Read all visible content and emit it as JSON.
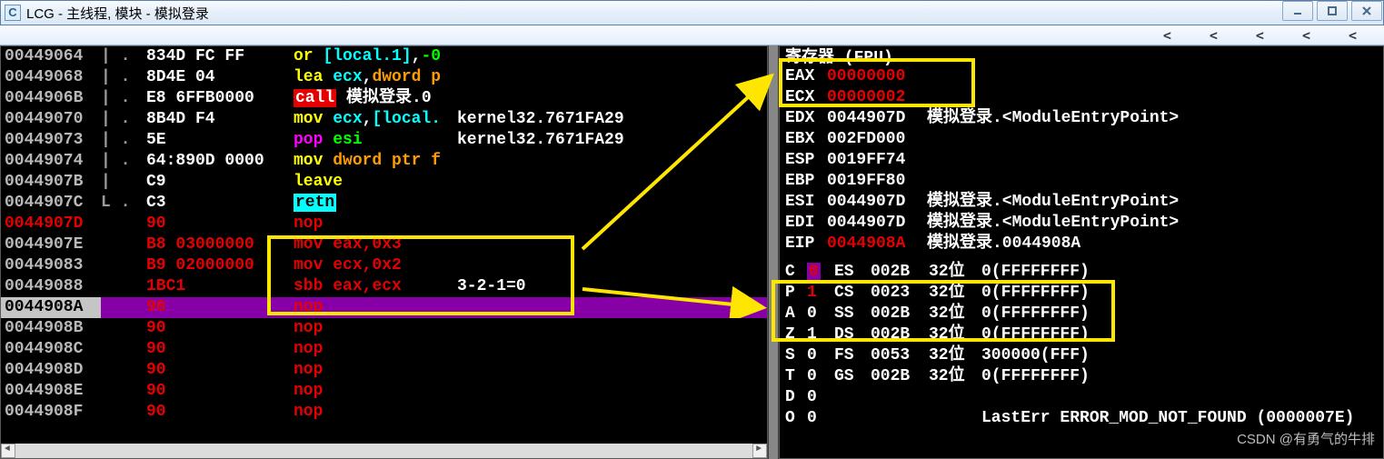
{
  "window": {
    "icon_letter": "C",
    "title": "LCG - 主线程, 模块 - 模拟登录"
  },
  "topmenu": {
    "items": [
      "<",
      "<",
      "<",
      "<",
      "<"
    ]
  },
  "disasm": {
    "rows": [
      {
        "addr": "00449064",
        "addr_cls": "gray",
        "flow": "| .",
        "bytes": "834D FC FF",
        "bcls": "white",
        "dis": [
          {
            "t": "or ",
            "c": "yellow"
          },
          {
            "t": "[local.1]",
            "c": "cyan"
          },
          {
            "t": ",",
            "c": "white"
          },
          {
            "t": "-0",
            "c": "green"
          }
        ],
        "cmt": ""
      },
      {
        "addr": "00449068",
        "addr_cls": "gray",
        "flow": "| .",
        "bytes": "8D4E 04",
        "bcls": "white",
        "dis": [
          {
            "t": "lea ",
            "c": "yellow"
          },
          {
            "t": "ecx",
            "c": "cyan"
          },
          {
            "t": ",",
            "c": "white"
          },
          {
            "t": "dword p",
            "c": "orange"
          }
        ],
        "cmt": ""
      },
      {
        "addr": "0044906B",
        "addr_cls": "gray",
        "flow": "| .",
        "bytes": "E8 6FFB0000",
        "bcls": "white",
        "dis": [
          {
            "t": "call",
            "c": "bg-red"
          },
          {
            "t": " 模拟登录.0",
            "c": "white"
          }
        ],
        "cmt": ""
      },
      {
        "addr": "00449070",
        "addr_cls": "gray",
        "flow": "| .",
        "bytes": "8B4D F4",
        "bcls": "white",
        "dis": [
          {
            "t": "mov ",
            "c": "yellow"
          },
          {
            "t": "ecx",
            "c": "cyan"
          },
          {
            "t": ",",
            "c": "white"
          },
          {
            "t": "[local.",
            "c": "cyan"
          }
        ],
        "cmt": "kernel32.7671FA29"
      },
      {
        "addr": "00449073",
        "addr_cls": "gray",
        "flow": "| .",
        "bytes": "5E",
        "bcls": "white",
        "dis": [
          {
            "t": "pop ",
            "c": "magenta"
          },
          {
            "t": "esi",
            "c": "green"
          }
        ],
        "cmt": "kernel32.7671FA29"
      },
      {
        "addr": "00449074",
        "addr_cls": "gray",
        "flow": "| .",
        "bytes": "64:890D 0000",
        "bcls": "white",
        "dis": [
          {
            "t": "mov ",
            "c": "yellow"
          },
          {
            "t": "dword ptr f",
            "c": "orange"
          }
        ],
        "cmt": ""
      },
      {
        "addr": "0044907B",
        "addr_cls": "gray",
        "flow": "|  ",
        "bytes": "C9",
        "bcls": "white",
        "dis": [
          {
            "t": "leave",
            "c": "yellow"
          }
        ],
        "cmt": ""
      },
      {
        "addr": "0044907C",
        "addr_cls": "gray",
        "flow": "L .",
        "bytes": "C3",
        "bcls": "white",
        "dis": [
          {
            "t": "retn",
            "c": "bg-cyan"
          }
        ],
        "cmt": ""
      },
      {
        "addr": "0044907D",
        "addr_cls": "red",
        "flow": "",
        "bytes": "90",
        "bcls": "red",
        "dis": [
          {
            "t": "nop",
            "c": "red"
          }
        ],
        "cmt": ""
      },
      {
        "addr": "0044907E",
        "addr_cls": "gray",
        "flow": "",
        "bytes": "B8 03000000",
        "bcls": "red",
        "dis": [
          {
            "t": "mov ",
            "c": "red"
          },
          {
            "t": "eax",
            "c": "red"
          },
          {
            "t": ",0x3",
            "c": "red"
          }
        ],
        "cmt": ""
      },
      {
        "addr": "00449083",
        "addr_cls": "gray",
        "flow": "",
        "bytes": "B9 02000000",
        "bcls": "red",
        "dis": [
          {
            "t": "mov ",
            "c": "red"
          },
          {
            "t": "ecx",
            "c": "red"
          },
          {
            "t": ",0x2",
            "c": "red"
          }
        ],
        "cmt": ""
      },
      {
        "addr": "00449088",
        "addr_cls": "gray",
        "flow": "",
        "bytes": "1BC1",
        "bcls": "red",
        "dis": [
          {
            "t": "sbb ",
            "c": "red"
          },
          {
            "t": "eax",
            "c": "red"
          },
          {
            "t": ",",
            "c": "red"
          },
          {
            "t": "ecx",
            "c": "red"
          }
        ],
        "cmt": "3-2-1=0"
      },
      {
        "addr": "0044908A",
        "addr_cls": "sel",
        "flow": "",
        "bytes": "90",
        "bcls": "red",
        "dis": [
          {
            "t": "nop",
            "c": "red"
          }
        ],
        "cmt": "",
        "sel": true
      },
      {
        "addr": "0044908B",
        "addr_cls": "gray",
        "flow": "",
        "bytes": "90",
        "bcls": "red",
        "dis": [
          {
            "t": "nop",
            "c": "red"
          }
        ],
        "cmt": ""
      },
      {
        "addr": "0044908C",
        "addr_cls": "gray",
        "flow": "",
        "bytes": "90",
        "bcls": "red",
        "dis": [
          {
            "t": "nop",
            "c": "red"
          }
        ],
        "cmt": ""
      },
      {
        "addr": "0044908D",
        "addr_cls": "gray",
        "flow": "",
        "bytes": "90",
        "bcls": "red",
        "dis": [
          {
            "t": "nop",
            "c": "red"
          }
        ],
        "cmt": ""
      },
      {
        "addr": "0044908E",
        "addr_cls": "gray",
        "flow": "",
        "bytes": "90",
        "bcls": "red",
        "dis": [
          {
            "t": "nop",
            "c": "red"
          }
        ],
        "cmt": ""
      },
      {
        "addr": "0044908F",
        "addr_cls": "gray",
        "flow": "",
        "bytes": "90",
        "bcls": "red",
        "dis": [
          {
            "t": "nop",
            "c": "red"
          }
        ],
        "cmt": ""
      }
    ],
    "comment_annotation": "3-2-1=0"
  },
  "registers": {
    "title": "寄存器 (FPU)",
    "rows": [
      {
        "name": "EAX",
        "val": "00000000",
        "vc": "red",
        "extra": ""
      },
      {
        "name": "ECX",
        "val": "00000002",
        "vc": "red",
        "extra": ""
      },
      {
        "name": "EDX",
        "val": "0044907D",
        "vc": "white",
        "extra": "模拟登录.<ModuleEntryPoint>"
      },
      {
        "name": "EBX",
        "val": "002FD000",
        "vc": "white",
        "extra": ""
      },
      {
        "name": "ESP",
        "val": "0019FF74",
        "vc": "white",
        "extra": ""
      },
      {
        "name": "EBP",
        "val": "0019FF80",
        "vc": "white",
        "extra": ""
      },
      {
        "name": "ESI",
        "val": "0044907D",
        "vc": "white",
        "extra": "模拟登录.<ModuleEntryPoint>"
      },
      {
        "name": "EDI",
        "val": "0044907D",
        "vc": "white",
        "extra": "模拟登录.<ModuleEntryPoint>"
      },
      {
        "name": "EIP",
        "val": "0044908A",
        "vc": "red",
        "extra": "模拟登录.0044908A"
      }
    ],
    "flags": [
      {
        "n": "C",
        "v": "0",
        "vc": "bg-mag",
        "seg": "ES",
        "sv": "002B",
        "bit": "32位",
        "rng": "0(FFFFFFFF)"
      },
      {
        "n": "P",
        "v": "1",
        "vc": "red",
        "seg": "CS",
        "sv": "0023",
        "bit": "32位",
        "rng": "0(FFFFFFFF)"
      },
      {
        "n": "A",
        "v": "0",
        "vc": "white",
        "seg": "SS",
        "sv": "002B",
        "bit": "32位",
        "rng": "0(FFFFFFFF)"
      },
      {
        "n": "Z",
        "v": "1",
        "vc": "white",
        "seg": "DS",
        "sv": "002B",
        "bit": "32位",
        "rng": "0(FFFFFFFF)"
      },
      {
        "n": "S",
        "v": "0",
        "vc": "white",
        "seg": "FS",
        "sv": "0053",
        "bit": "32位",
        "rng": "300000(FFF)"
      },
      {
        "n": "T",
        "v": "0",
        "vc": "white",
        "seg": "GS",
        "sv": "002B",
        "bit": "32位",
        "rng": "0(FFFFFFFF)"
      },
      {
        "n": "D",
        "v": "0",
        "vc": "white",
        "seg": "",
        "sv": "",
        "bit": "",
        "rng": ""
      },
      {
        "n": "O",
        "v": "0",
        "vc": "white",
        "seg": "",
        "sv": "",
        "bit": "",
        "rng": "LastErr ERROR_MOD_NOT_FOUND (0000007E)"
      }
    ]
  },
  "watermark": "CSDN @有勇气的牛排"
}
